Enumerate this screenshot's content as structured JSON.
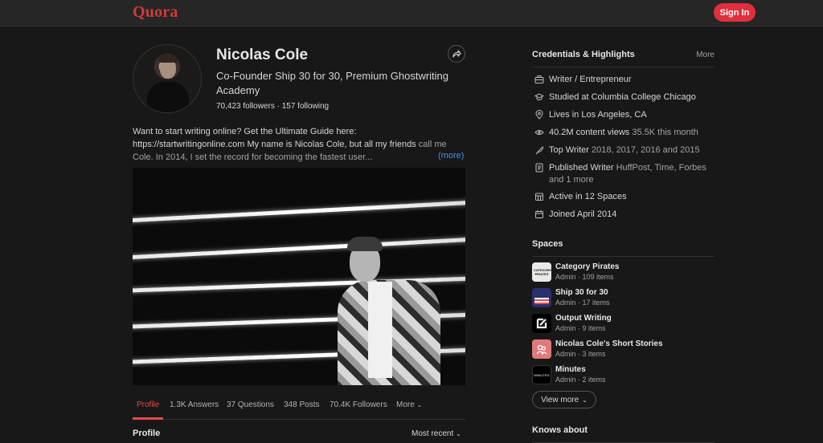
{
  "header": {
    "logo": "Quora",
    "sign_in": "Sign In"
  },
  "profile": {
    "name": "Nicolas Cole",
    "tagline": "Co-Founder Ship 30 for 30, Premium Ghostwriting Academy",
    "followers_line": "70,423 followers · 157 following",
    "bio_main": "Want to start writing online? Get the Ultimate Guide here: https://startwritingonline.com My name is Nicolas Cole, but all my friends",
    "bio_faded": " call me Cole. In 2014, I set the record for becoming the fastest user...",
    "more_link": "(more)"
  },
  "tabs": [
    {
      "label": "Profile",
      "active": true
    },
    {
      "label": "1.3K Answers"
    },
    {
      "label": "37 Questions"
    },
    {
      "label": "348 Posts"
    },
    {
      "label": "70.4K Followers"
    },
    {
      "label": "More"
    }
  ],
  "section": {
    "title": "Profile",
    "sort": "Most recent"
  },
  "credentials": {
    "title": "Credentials & Highlights",
    "more": "More",
    "items": [
      {
        "icon": "briefcase-icon",
        "text": "Writer / Entrepreneur",
        "dim": ""
      },
      {
        "icon": "graduation-icon",
        "text": "Studied at Columbia College Chicago",
        "dim": ""
      },
      {
        "icon": "location-pin-icon",
        "text": "Lives in Los Angeles, CA",
        "dim": ""
      },
      {
        "icon": "eye-icon",
        "text": "40.2M content views ",
        "dim": "35.5K this month"
      },
      {
        "icon": "feather-icon",
        "text": "Top Writer ",
        "dim": "2018, 2017, 2016 and 2015"
      },
      {
        "icon": "document-icon",
        "text": "Published Writer ",
        "dim": "HuffPost, Time, Forbes and 1 more"
      },
      {
        "icon": "spaces-icon",
        "text": "Active in 12 Spaces",
        "dim": ""
      },
      {
        "icon": "calendar-icon",
        "text": "Joined April 2014",
        "dim": ""
      }
    ]
  },
  "spaces": {
    "title": "Spaces",
    "items": [
      {
        "name": "Category Pirates",
        "meta": "Admin · 109 items",
        "thumb_color": "#e9e9e9",
        "thumb_text": "CATEGORY PIRATES"
      },
      {
        "name": "Ship 30 for 30",
        "meta": "Admin · 17 items",
        "thumb_color": "#2b2f6e",
        "thumb_text": ""
      },
      {
        "name": "Output Writing",
        "meta": "Admin · 9 items",
        "thumb_color": "#000000",
        "thumb_text": ""
      },
      {
        "name": "Nicolas Cole's Short Stories",
        "meta": "Admin · 3 items",
        "thumb_color": "#e07a7a",
        "thumb_text": ""
      },
      {
        "name": "Minutes",
        "meta": "Admin · 2 items",
        "thumb_color": "#000000",
        "thumb_text": "MINUTES"
      }
    ],
    "view_more": "View more"
  },
  "knows_about": {
    "title": "Knows about"
  }
}
